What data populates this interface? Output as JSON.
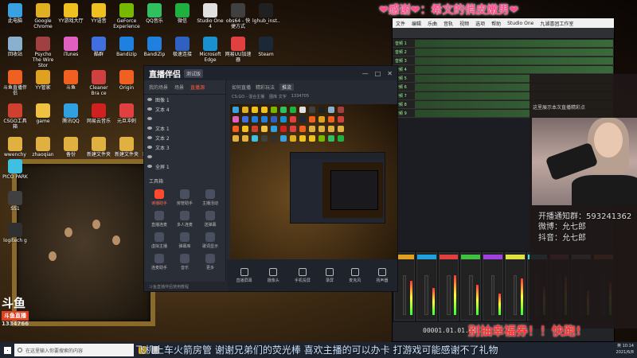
{
  "banner": "❤感谢❤：希文的俏皮嫩男❤",
  "desktop_icons": [
    {
      "label": "此电脑",
      "color": "#3aa0e0"
    },
    {
      "label": "Google Chrome",
      "color": "#e0b020"
    },
    {
      "label": "YY游戏大厅",
      "color": "#f0c020"
    },
    {
      "label": "YY语音",
      "color": "#f0c020"
    },
    {
      "label": "GeForce Experience",
      "color": "#76b900"
    },
    {
      "label": "QQ音乐",
      "color": "#30c060"
    },
    {
      "label": "微信",
      "color": "#20b040"
    },
    {
      "label": "Studio One 4",
      "color": "#e0e0e0"
    },
    {
      "label": "obs64 - 快捷方式",
      "color": "#404040"
    },
    {
      "label": "lghub_inst...",
      "color": "#202020"
    },
    {
      "label": "回收站",
      "color": "#8ab0d0"
    },
    {
      "label": "Psycho The Wire Stor",
      "color": "#a04040"
    },
    {
      "label": "iTunes",
      "color": "#e060c0"
    },
    {
      "label": "酷群",
      "color": "#4070e0"
    },
    {
      "label": "Bandizip",
      "color": "#2080e0"
    },
    {
      "label": "BandiZip",
      "color": "#2080e0"
    },
    {
      "label": "极速连接",
      "color": "#3060c0"
    },
    {
      "label": "Microsoft Edge",
      "color": "#1a90d0"
    },
    {
      "label": "网易UU加速器",
      "color": "#e04040"
    },
    {
      "label": "Steam",
      "color": "#1b2838"
    },
    {
      "label": "斗鱼直播伴侣",
      "color": "#f06020"
    },
    {
      "label": "YY管家",
      "color": "#e0a020"
    },
    {
      "label": "斗鱼",
      "color": "#f06020"
    },
    {
      "label": "Cleaner Bra ce",
      "color": "#d04040"
    },
    {
      "label": "Origin",
      "color": "#f06020"
    },
    {
      "label": "YY开播",
      "color": "#f0c020"
    },
    {
      "label": "CSGO工具箱",
      "color": "#d04030"
    },
    {
      "label": "game",
      "color": "#f0c040"
    },
    {
      "label": "腾讯QQ",
      "color": "#30a0e0"
    },
    {
      "label": "网易云音乐",
      "color": "#d02020"
    },
    {
      "label": "元旦冲刺",
      "color": "#e04040"
    },
    {
      "label": "斗鱼直播",
      "color": "#f06020"
    },
    {
      "label": "wwenchy",
      "color": "#e0b040"
    },
    {
      "label": "zhaoqian",
      "color": "#e0b040"
    },
    {
      "label": "备份",
      "color": "#e0b040"
    },
    {
      "label": "新建文件夹",
      "color": "#e0b040"
    },
    {
      "label": "新建文件夹",
      "color": "#e0b040"
    },
    {
      "label": "新建文件夹",
      "color": "#e0b040"
    },
    {
      "label": "PICO PARK",
      "color": "#40c0e0"
    },
    {
      "label": "SS1",
      "color": "#404040"
    },
    {
      "label": "logitech g",
      "color": "#303030"
    }
  ],
  "app": {
    "logo": "直播伴侣",
    "version": "测试版",
    "left_tabs": [
      "我的场景",
      "场景",
      "直播源"
    ],
    "scenes": [
      "图像 1",
      "文本 4",
      "",
      "文本 1",
      "文本 2",
      "文本 3",
      "",
      "全屏 1"
    ],
    "tools_title": "工具箱",
    "tools": [
      "读播助手",
      "房管助手",
      "主播活动",
      "直播连麦",
      "多人连麦",
      "送弹幕",
      "虚拟主播",
      "弹幕库",
      "歌词显示",
      "连麦助手",
      "音乐",
      "更多"
    ],
    "status": "斗鱼直播伴侣使用教程",
    "right_tabs": [
      "如何直播",
      "精彩玩法",
      "推流"
    ],
    "game_row": [
      "CS:GO - 混合主播",
      "图库 文字",
      "1334705"
    ],
    "bottom_buttons": [
      "直播屏幕",
      "摄像头",
      "手机投屏",
      "录屏",
      "麦克风",
      "扬声器"
    ]
  },
  "daw": {
    "menu": [
      "文件",
      "编辑",
      "乐曲",
      "音轨",
      "视频",
      "选项",
      "帮助",
      "Studio One",
      "九湖喜团工作室"
    ],
    "tracks": [
      "音频 1",
      "音频 2",
      "音频 3",
      "音频 4",
      "音频 5",
      "音频 6",
      "音频 7",
      "音频 8",
      "音频 9"
    ],
    "time": "00001.01.01.00"
  },
  "chat": {
    "rows": [
      "这里展示本次直播精彩点",
      "",
      "开播通知群：593241362",
      "微博：允七郎",
      "抖音：允七郎"
    ],
    "notice1": "开播通知群：593241362",
    "notice2": "微博：允七郎",
    "notice3": "抖音：允七郎"
  },
  "lottery": "别抽幸福券！！快跑!",
  "marquee": "飞机上车火箭房管 谢谢兄弟们的荧光棒 喜欢主播的可以办卡 打游戏可能感谢不了礼物",
  "taskbar": {
    "search_placeholder": "在这里输入你要搜索的内容",
    "time": "10:14",
    "date": "2021/6/8",
    "lang": "英"
  },
  "overlay": {
    "room_logo": "斗鱼",
    "room_sub": "斗鱼直播",
    "room_id": "1334766"
  }
}
